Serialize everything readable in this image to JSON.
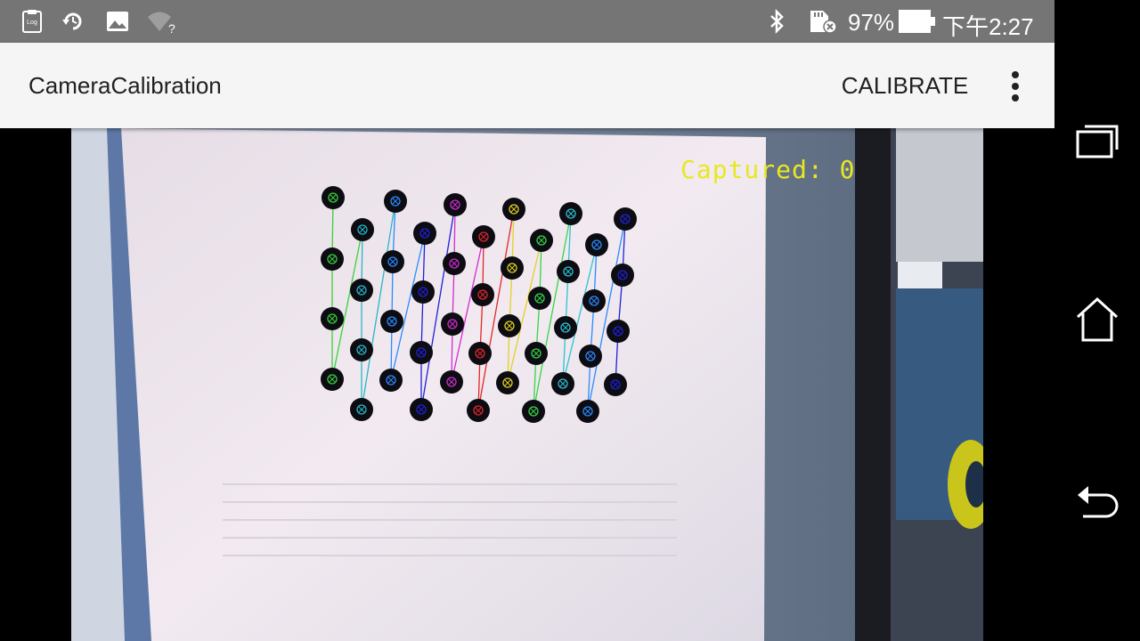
{
  "status_bar": {
    "battery_percent": "97%",
    "clock": "下午2:27",
    "icons": [
      "log-icon",
      "sync-icon",
      "image-icon",
      "wifi-question-icon",
      "bluetooth-icon",
      "sdcard-error-icon",
      "battery-icon"
    ],
    "background": "#757575"
  },
  "app_bar": {
    "title": "CameraCalibration",
    "calibrate_label": "CALIBRATE",
    "overflow_icon": "more-vert-icon",
    "background": "#f5f5f5"
  },
  "preview": {
    "captured_text": "Captured: 0",
    "overlay_color": "#e8e821"
  },
  "nav_bar": {
    "icons": [
      "recents-icon",
      "home-icon",
      "back-icon"
    ]
  }
}
